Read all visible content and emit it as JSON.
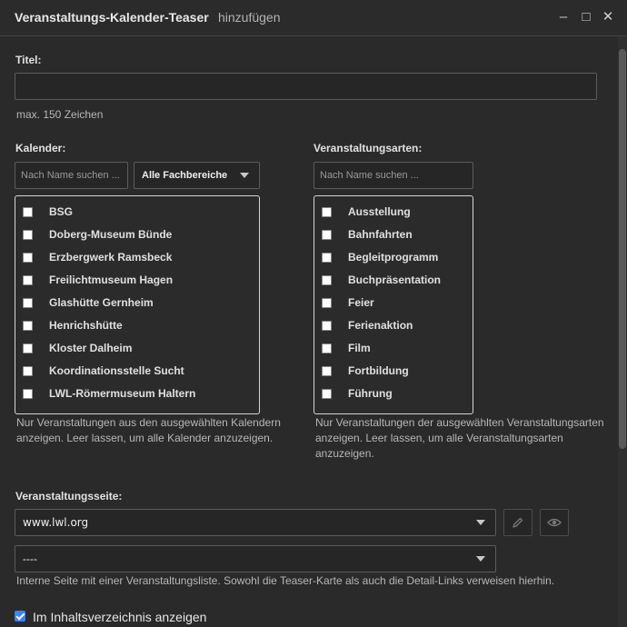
{
  "window": {
    "title": "Veranstaltungs-Kalender-Teaser",
    "subtitle": "hinzufügen",
    "minimize_glyph": "–",
    "maximize_glyph": "□",
    "close_glyph": "✕"
  },
  "titel": {
    "label": "Titel:",
    "value": "",
    "help": "max. 150 Zeichen"
  },
  "kalender": {
    "label": "Kalender:",
    "search_placeholder": "Nach Name suchen ...",
    "filter_value": "Alle Fachbereiche",
    "items": [
      {
        "label": "BSG",
        "checked": false
      },
      {
        "label": "Doberg-Museum Bünde",
        "checked": false
      },
      {
        "label": "Erzbergwerk Ramsbeck",
        "checked": false
      },
      {
        "label": "Freilichtmuseum Hagen",
        "checked": false
      },
      {
        "label": "Glashütte Gernheim",
        "checked": false
      },
      {
        "label": "Henrichshütte",
        "checked": false
      },
      {
        "label": "Kloster Dalheim",
        "checked": false
      },
      {
        "label": "Koordinationsstelle Sucht",
        "checked": false
      },
      {
        "label": "LWL-Römermuseum Haltern",
        "checked": false
      }
    ],
    "help_line1": "Nur Veranstaltungen aus den ausgewählten Kalendern",
    "help_line2": "anzeigen. Leer lassen, um alle Kalender anzuzeigen."
  },
  "arten": {
    "label": "Veranstaltungsarten:",
    "search_placeholder": "Nach Name suchen ...",
    "items": [
      {
        "label": "Ausstellung",
        "checked": false
      },
      {
        "label": "Bahnfahrten",
        "checked": false
      },
      {
        "label": "Begleitprogramm",
        "checked": false
      },
      {
        "label": "Buchpräsentation",
        "checked": false
      },
      {
        "label": "Feier",
        "checked": false
      },
      {
        "label": "Ferienaktion",
        "checked": false
      },
      {
        "label": "Film",
        "checked": false
      },
      {
        "label": "Fortbildung",
        "checked": false
      },
      {
        "label": "Führung",
        "checked": false
      }
    ],
    "help_line1": "Nur Veranstaltungen der ausgewählten Veranstaltungsarten",
    "help_line2": "anzeigen. Leer lassen, um alle Veranstaltungsarten",
    "help_line3": "anzuzeigen."
  },
  "seite": {
    "label": "Veranstaltungsseite:",
    "site_value": "www.lwl.org",
    "page_value": "----",
    "help": "Interne Seite mit einer Veranstaltungsliste. Sowohl die Teaser-Karte als auch die Detail-Links verweisen hierhin."
  },
  "inhaltsverzeichnis": {
    "label": "Im Inhaltsverzeichnis anzeigen",
    "checked": true
  }
}
